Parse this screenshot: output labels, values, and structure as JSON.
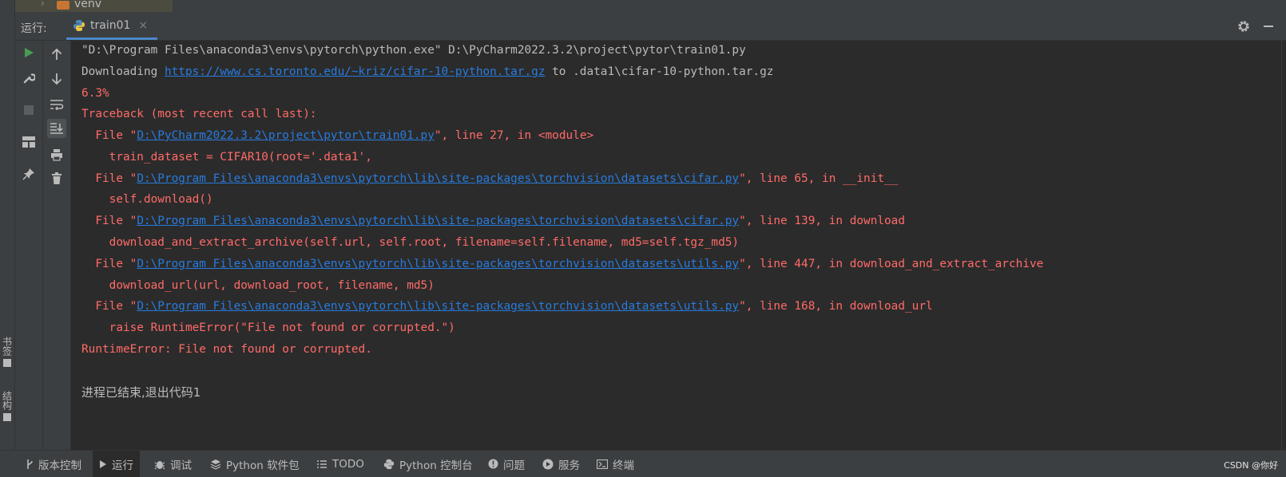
{
  "project_tree": {
    "folder_label": "venv"
  },
  "left_strip": {
    "bookmarks_label": "书签",
    "structure_label": "结构"
  },
  "run_window": {
    "label": "运行:",
    "tab": {
      "label": "train01"
    }
  },
  "console": {
    "cmd_line": "\"D:\\Program Files\\anaconda3\\envs\\pytorch\\python.exe\" D:\\PyCharm2022.3.2\\project\\pytor\\train01.py",
    "download_prefix": "Downloading ",
    "download_url": "https://www.cs.toronto.edu/~kriz/cifar-10-python.tar.gz",
    "download_suffix": " to .data1\\cifar-10-python.tar.gz",
    "progress": "6.3%",
    "traceback_header": "Traceback (most recent call last):",
    "frames": [
      {
        "prefix": "  File \"",
        "path": "D:\\PyCharm2022.3.2\\project\\pytor\\train01.py",
        "suffix": "\", line 27, in <module>",
        "code": "    train_dataset = CIFAR10(root='.data1',"
      },
      {
        "prefix": "  File \"",
        "path": "D:\\Program Files\\anaconda3\\envs\\pytorch\\lib\\site-packages\\torchvision\\datasets\\cifar.py",
        "suffix": "\", line 65, in __init__",
        "code": "    self.download()"
      },
      {
        "prefix": "  File \"",
        "path": "D:\\Program Files\\anaconda3\\envs\\pytorch\\lib\\site-packages\\torchvision\\datasets\\cifar.py",
        "suffix": "\", line 139, in download",
        "code": "    download_and_extract_archive(self.url, self.root, filename=self.filename, md5=self.tgz_md5)"
      },
      {
        "prefix": "  File \"",
        "path": "D:\\Program Files\\anaconda3\\envs\\pytorch\\lib\\site-packages\\torchvision\\datasets\\utils.py",
        "suffix": "\", line 447, in download_and_extract_archive",
        "code": "    download_url(url, download_root, filename, md5)"
      },
      {
        "prefix": "  File \"",
        "path": "D:\\Program Files\\anaconda3\\envs\\pytorch\\lib\\site-packages\\torchvision\\datasets\\utils.py",
        "suffix": "\", line 168, in download_url",
        "code": "    raise RuntimeError(\"File not found or corrupted.\")"
      }
    ],
    "error_line": "RuntimeError: File not found or corrupted.",
    "exit_line": "进程已结束,退出代码1"
  },
  "bottom_bar": {
    "items": [
      {
        "label": "版本控制",
        "icon": "branch-icon"
      },
      {
        "label": "运行",
        "icon": "play-icon"
      },
      {
        "label": "调试",
        "icon": "bug-icon"
      },
      {
        "label": "Python 软件包",
        "icon": "layers-icon"
      },
      {
        "label": "TODO",
        "icon": "list-icon"
      },
      {
        "label": "Python 控制台",
        "icon": "python-icon"
      },
      {
        "label": "问题",
        "icon": "alert-icon"
      },
      {
        "label": "服务",
        "icon": "play-circle-icon"
      },
      {
        "label": "终端",
        "icon": "terminal-icon"
      }
    ]
  },
  "watermark": "CSDN @你好",
  "colors": {
    "error": "#ff6b68",
    "link": "#287bde",
    "text": "#bbbbbb",
    "run_green": "#499c54",
    "accent_tab": "#4a88c7"
  }
}
